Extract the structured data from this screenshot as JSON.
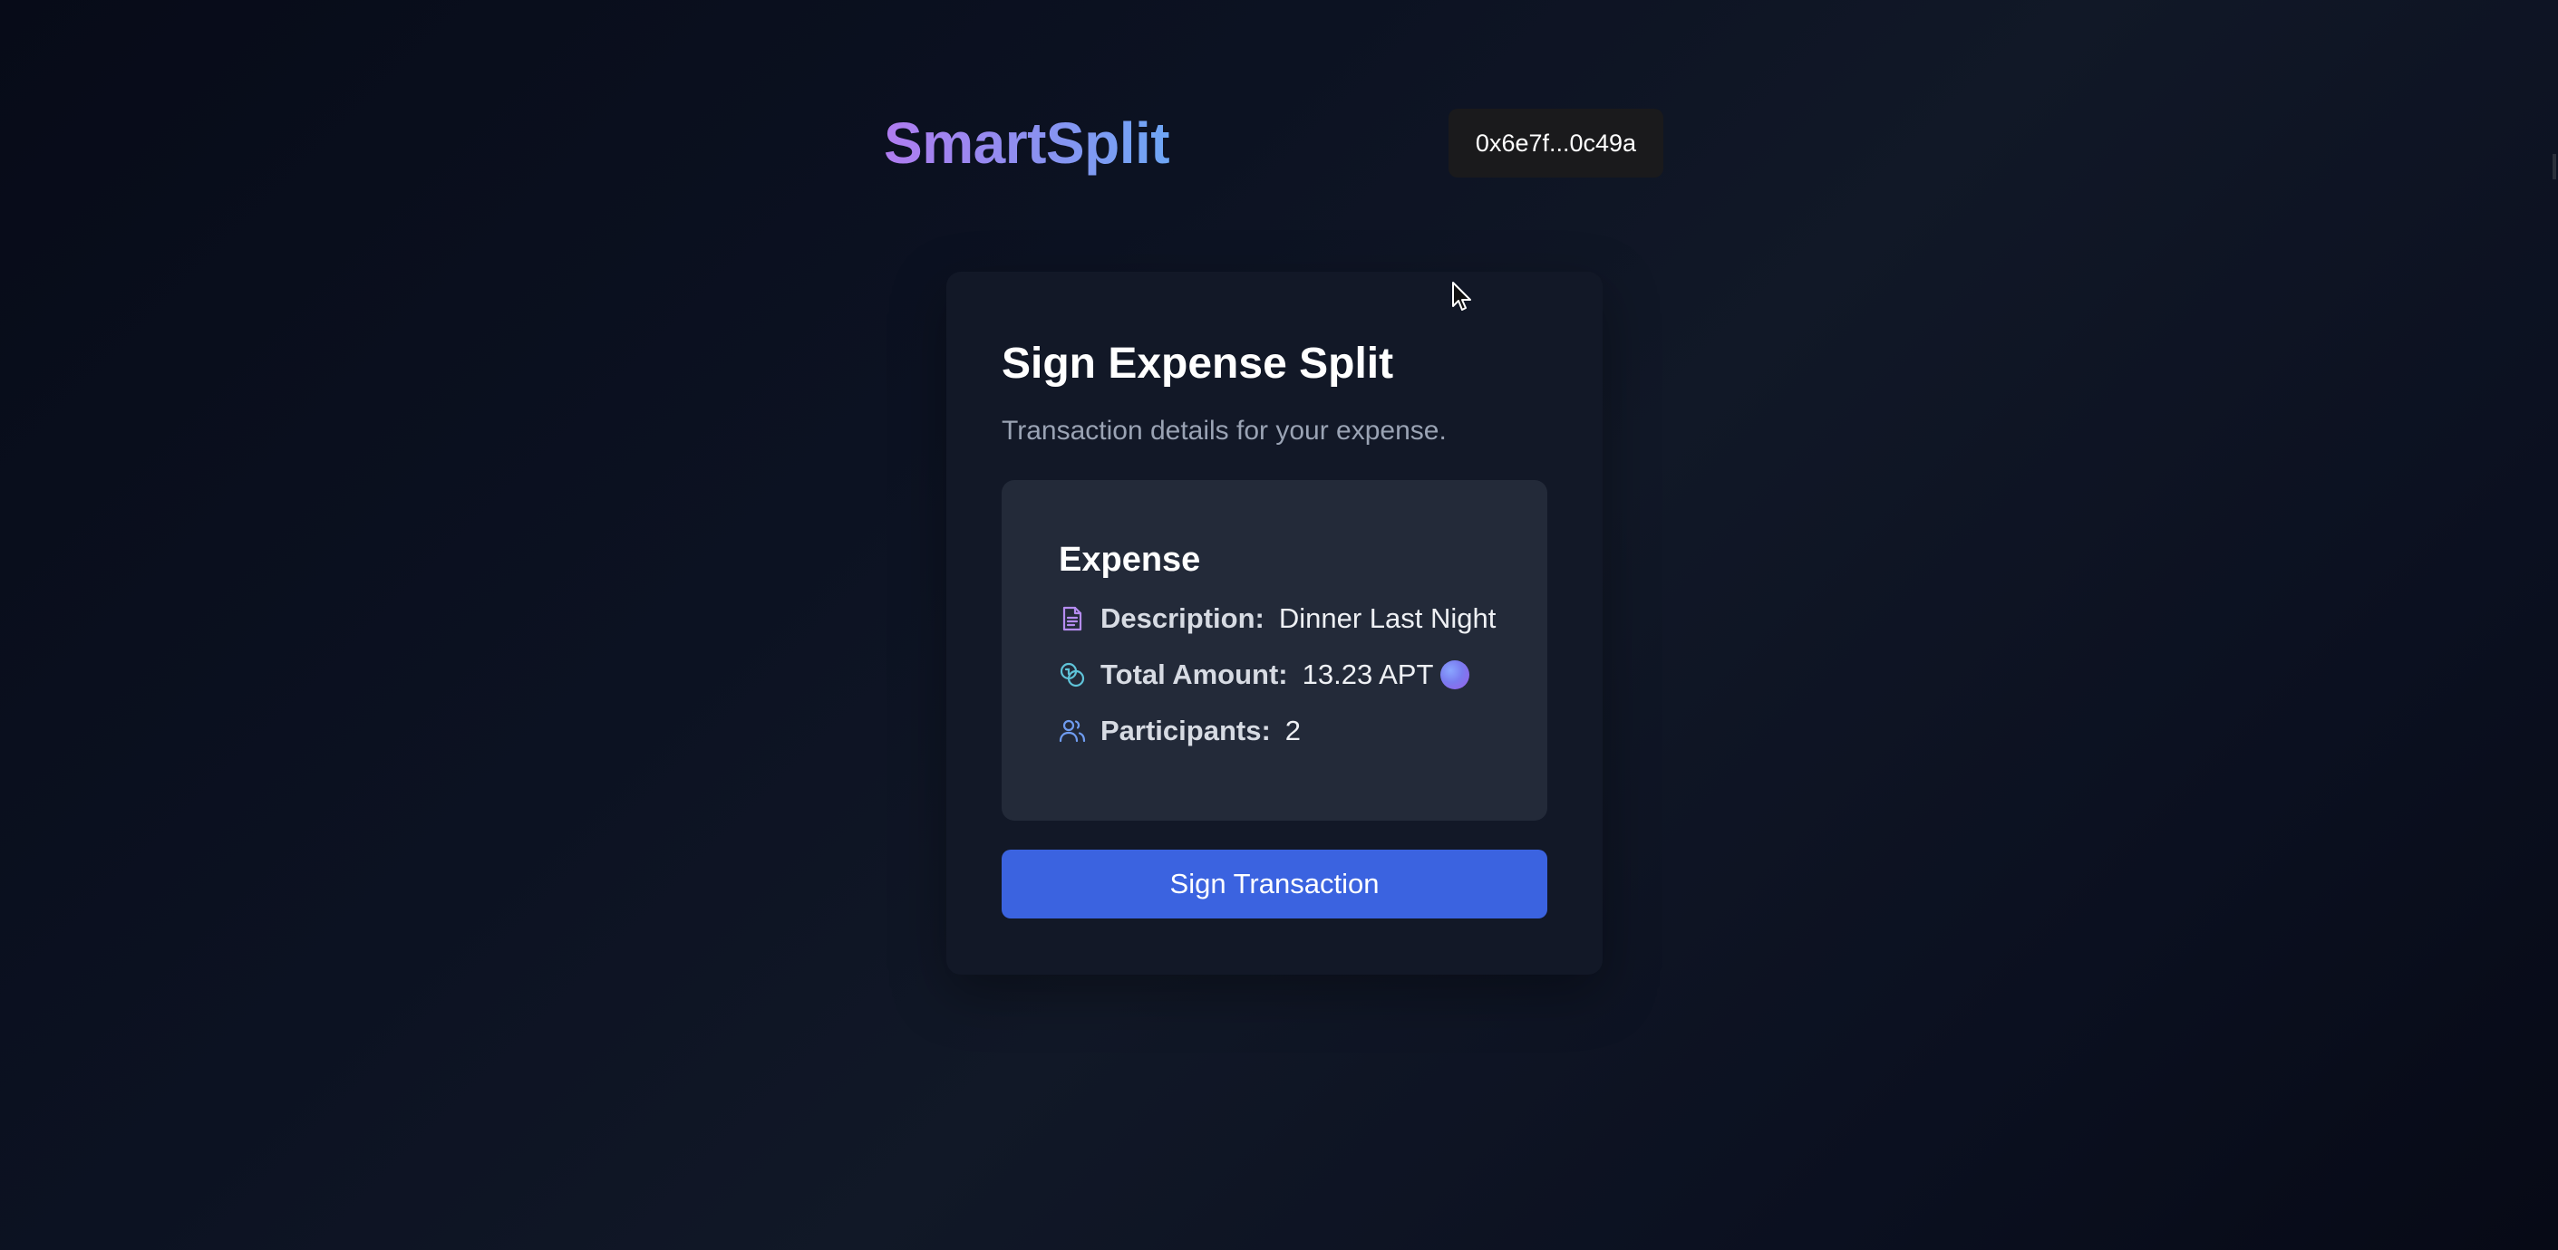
{
  "header": {
    "brand": "SmartSplit",
    "wallet_address": "0x6e7f...0c49a"
  },
  "card": {
    "title": "Sign Expense Split",
    "subtitle": "Transaction details for your expense.",
    "expense": {
      "heading": "Expense",
      "description_label": "Description:",
      "description_value": "Dinner Last Night",
      "total_label": "Total Amount:",
      "total_value": "13.23 APT",
      "participants_label": "Participants:",
      "participants_value": "2"
    },
    "sign_button_label": "Sign Transaction"
  },
  "icons": {
    "description": "document-icon",
    "total": "coins-icon",
    "participants": "users-icon",
    "token": "apt-token-icon"
  },
  "colors": {
    "brand_gradient_start": "#b07cf0",
    "brand_gradient_end": "#6ea6f5",
    "primary_button": "#3b63e0",
    "card_background": "#121827",
    "details_background": "#232a39",
    "document_icon": "#b58cf0",
    "coins_icon": "#5fc3d8",
    "users_icon": "#6f9cf0"
  }
}
